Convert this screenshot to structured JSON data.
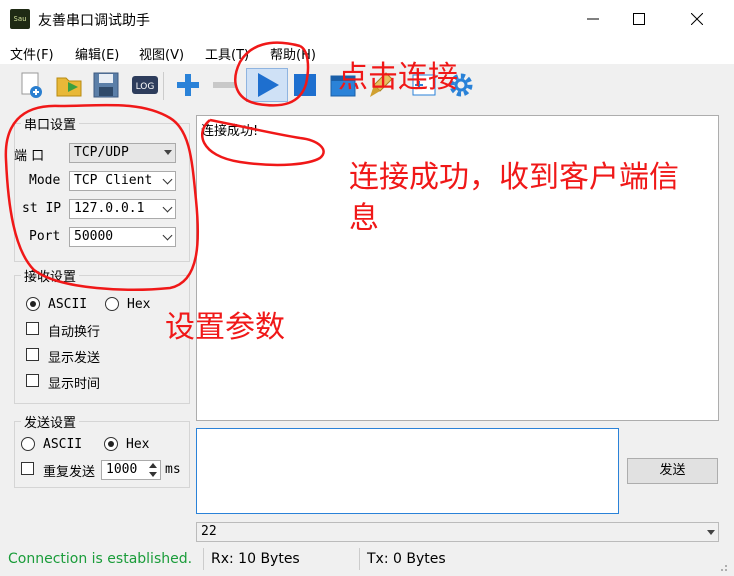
{
  "app": {
    "icon_text": "Sau",
    "title": "友善串口调试助手"
  },
  "menu": [
    "文件(F)",
    "编辑(E)",
    "视图(V)",
    "工具(T)",
    "帮助(H)"
  ],
  "toolbar": {
    "log_label": "LOG"
  },
  "serial_settings": {
    "legend": "串口设置",
    "port_label": "端  口",
    "port_value": "TCP/UDP",
    "mode_label": "Mode",
    "mode_value": "TCP Client",
    "ip_label": "st IP",
    "ip_value": "127.0.0.1",
    "port_num_label": "Port",
    "port_num_value": "50000"
  },
  "receive_settings": {
    "legend": "接收设置",
    "ascii": "ASCII",
    "hex": "Hex",
    "options": [
      "自动换行",
      "显示发送",
      "显示时间"
    ]
  },
  "send_settings": {
    "legend": "发送设置",
    "ascii": "ASCII",
    "hex": "Hex",
    "repeat_label": "重复发送",
    "interval_value": "1000",
    "unit": "ms"
  },
  "receive_area": {
    "text": "连接成功!"
  },
  "send_button": "发送",
  "history_combo": "22",
  "status": {
    "connection": "Connection is established.",
    "rx": "Rx: 10 Bytes",
    "tx": "Tx: 0 Bytes"
  },
  "colors": {
    "status_green": "#1a9c3a",
    "annotation_red": "#f01818",
    "play_blue": "#1e6fcf"
  },
  "annotations": {
    "click_connect": "点击连接",
    "connected_line1": "连接成功，收到客户端信",
    "connected_line2": "息",
    "set_params": "设置参数"
  }
}
